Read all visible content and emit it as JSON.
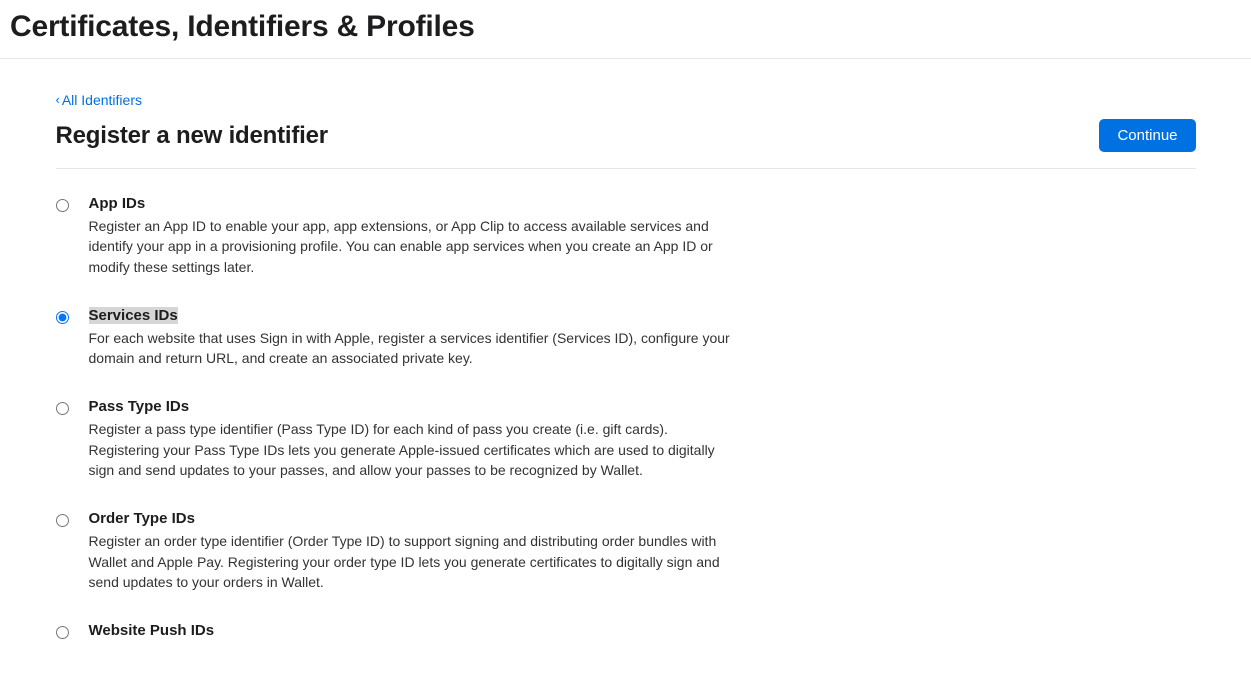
{
  "header": {
    "title": "Certificates, Identifiers & Profiles"
  },
  "breadcrumb": {
    "label": "All Identifiers"
  },
  "section": {
    "title": "Register a new identifier",
    "continue_label": "Continue"
  },
  "options": [
    {
      "id": "app-ids",
      "title": "App IDs",
      "desc": "Register an App ID to enable your app, app extensions, or App Clip to access available services and identify your app in a provisioning profile. You can enable app services when you create an App ID or modify these settings later.",
      "checked": false,
      "highlighted": false
    },
    {
      "id": "services-ids",
      "title": "Services IDs",
      "desc": "For each website that uses Sign in with Apple, register a services identifier (Services ID), configure your domain and return URL, and create an associated private key.",
      "checked": true,
      "highlighted": true
    },
    {
      "id": "pass-type-ids",
      "title": "Pass Type IDs",
      "desc": "Register a pass type identifier (Pass Type ID) for each kind of pass you create (i.e. gift cards). Registering your Pass Type IDs lets you generate Apple-issued certificates which are used to digitally sign and send updates to your passes, and allow your passes to be recognized by Wallet.",
      "checked": false,
      "highlighted": false
    },
    {
      "id": "order-type-ids",
      "title": "Order Type IDs",
      "desc": "Register an order type identifier (Order Type ID) to support signing and distributing order bundles with Wallet and Apple Pay. Registering your order type ID lets you generate certificates to digitally sign and send updates to your orders in Wallet.",
      "checked": false,
      "highlighted": false
    },
    {
      "id": "website-push-ids",
      "title": "Website Push IDs",
      "desc": "",
      "checked": false,
      "highlighted": false
    }
  ]
}
